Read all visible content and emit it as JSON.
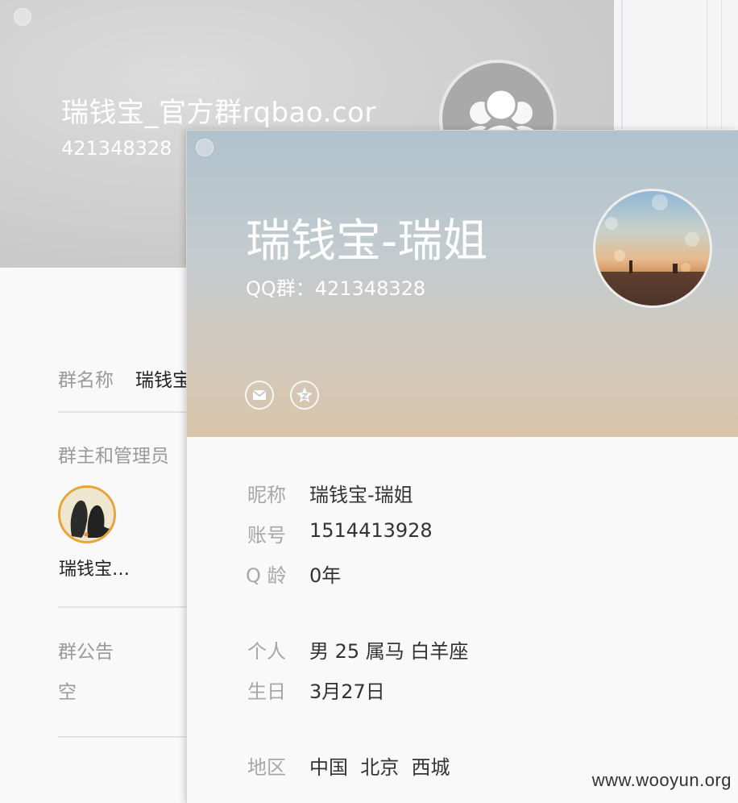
{
  "group_card": {
    "title": "瑞钱宝_官方群rqbao.cor",
    "group_id": "421348328",
    "fields": {
      "name_label": "群名称",
      "name_value": "瑞钱宝",
      "admins_label": "群主和管理员",
      "admin_name": "瑞钱宝…",
      "notice_label": "群公告",
      "notice_value": "空"
    }
  },
  "profile_card": {
    "name": "瑞钱宝-瑞姐",
    "qq_group": "QQ群：421348328",
    "actions": [
      {
        "icon": "mail-icon"
      },
      {
        "icon": "qzone-star-icon"
      }
    ],
    "info": {
      "nickname_label": "昵称",
      "nickname_value": "瑞钱宝-瑞姐",
      "account_label": "账号",
      "account_value": "1514413928",
      "qage_label": "Q 龄",
      "qage_value": "0年",
      "personal_label": "个人",
      "personal_value": "男 25 属马 白羊座",
      "birthday_label": "生日",
      "birthday_value": "3月27日",
      "region_label": "地区",
      "region_value": "中国  北京  西城"
    }
  },
  "watermark": "www.wooyun.org"
}
